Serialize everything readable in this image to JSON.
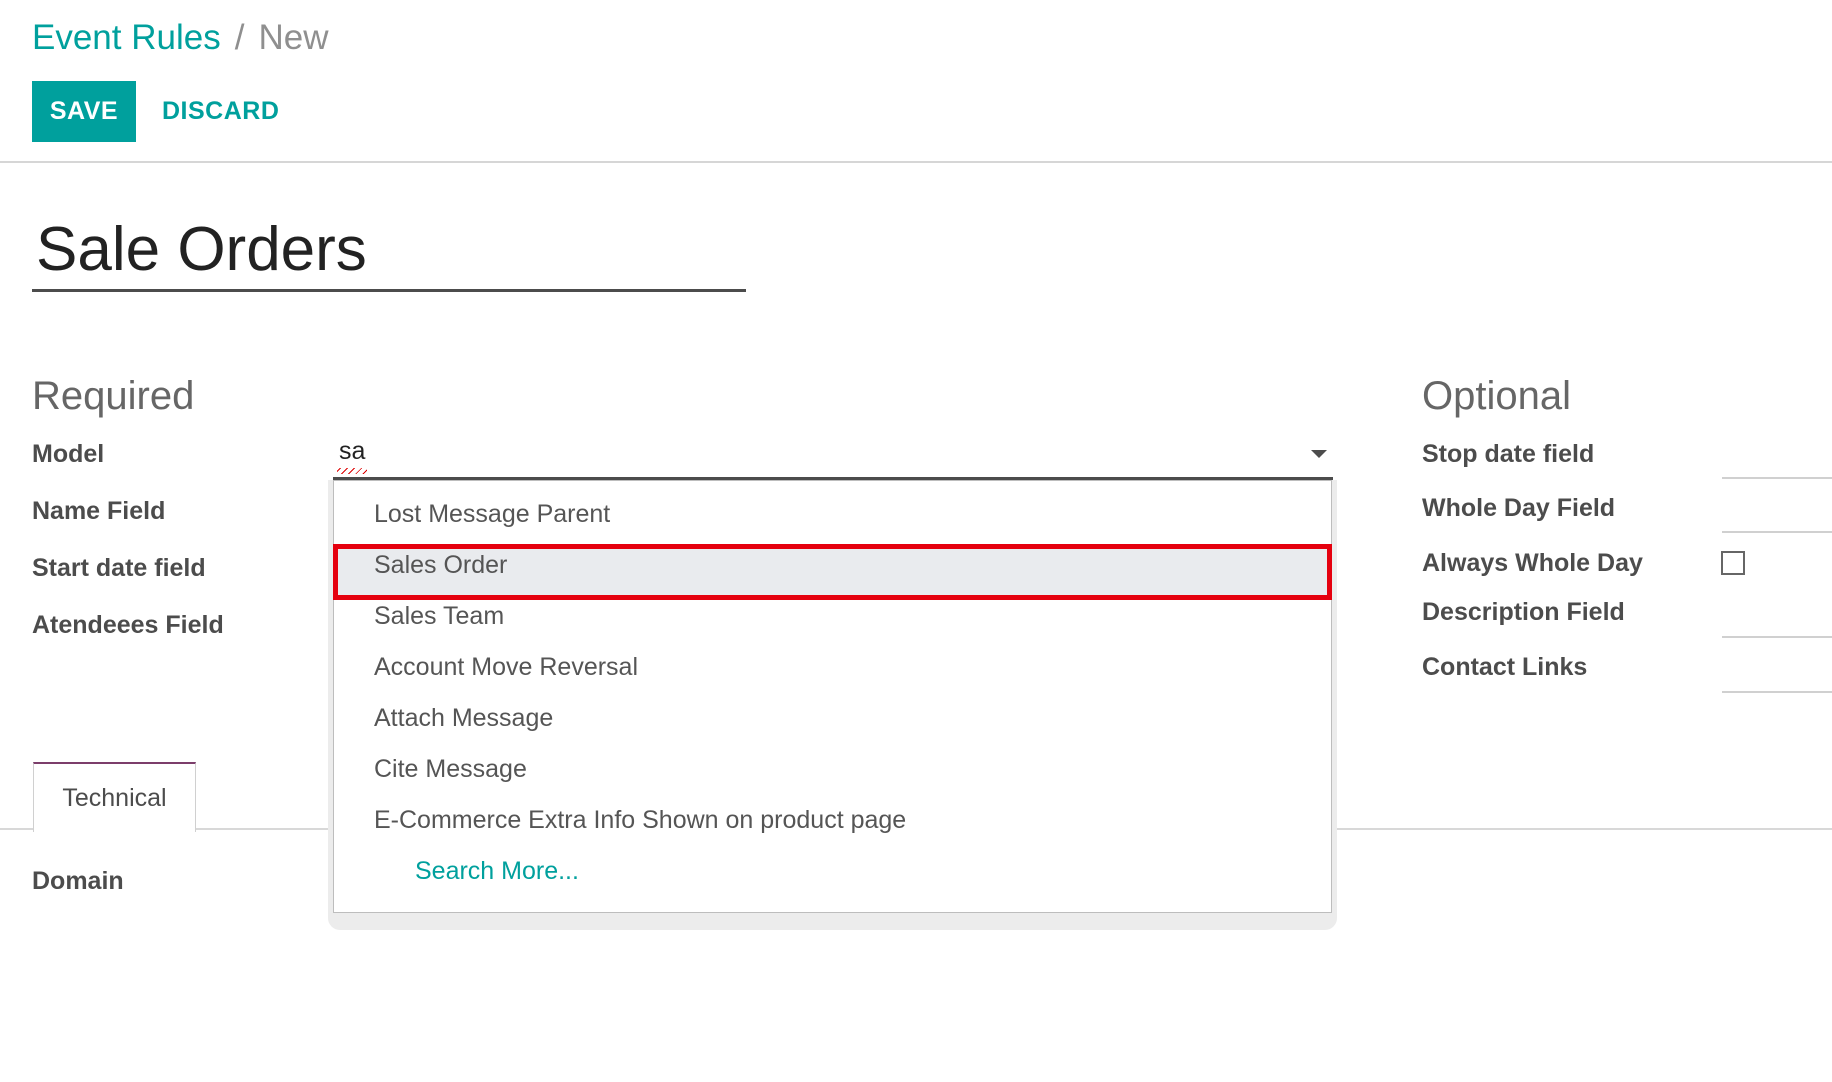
{
  "breadcrumb": {
    "parent": "Event Rules",
    "separator": "/",
    "current": "New"
  },
  "toolbar": {
    "save_label": "SAVE",
    "discard_label": "DISCARD"
  },
  "form": {
    "name_value": "Sale Orders",
    "required_title": "Required",
    "optional_title": "Optional",
    "required_labels": {
      "model": "Model",
      "name_field": "Name Field",
      "start_date_field": "Start date field",
      "attendees_field": "Atendeees Field"
    },
    "model_value": "sa",
    "optional_labels": {
      "stop_date_field": "Stop date field",
      "whole_day_field": "Whole Day Field",
      "always_whole_day": "Always Whole Day",
      "description_field": "Description Field",
      "contact_links": "Contact Links"
    },
    "always_whole_day_checked": false
  },
  "tabs": [
    {
      "label": "Technical",
      "active": true
    }
  ],
  "technical": {
    "domain_label": "Domain"
  },
  "dropdown": {
    "items": [
      "Lost Message Parent",
      "Sales Order",
      "Sales Team",
      "Account Move Reversal",
      "Attach Message",
      "Cite Message",
      "E-Commerce Extra Info Shown on product page"
    ],
    "highlighted_index": 1,
    "search_more": "Search More..."
  },
  "colors": {
    "accent": "#00a09d",
    "highlight_border": "#e5000e",
    "tab_top_border": "#7c3e6b"
  },
  "icons": {
    "dropdown_toggle": "caret-down-icon",
    "checkbox": "checkbox-unchecked-icon"
  }
}
